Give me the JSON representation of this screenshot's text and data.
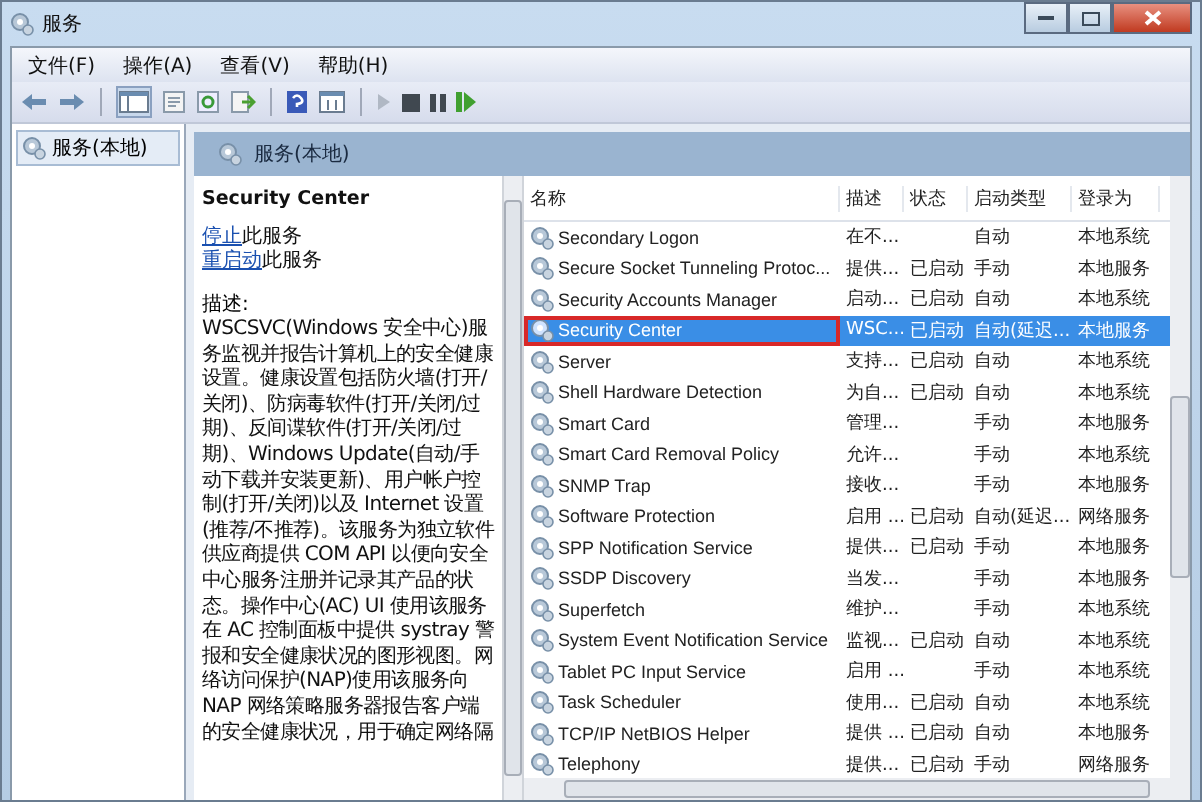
{
  "window": {
    "title": "服务"
  },
  "menu": [
    "文件(F)",
    "操作(A)",
    "查看(V)",
    "帮助(H)"
  ],
  "tree": {
    "items": [
      {
        "label": "服务(本地)",
        "selected": true
      }
    ]
  },
  "panel": {
    "header": "服务(本地)"
  },
  "detail": {
    "title": "Security Center",
    "actions": [
      {
        "link": "停止",
        "rest": "此服务"
      },
      {
        "link": "重启动",
        "rest": "此服务"
      }
    ],
    "description_label": "描述:",
    "description": "WSCSVC(Windows 安全中心)服务监视并报告计算机上的安全健康设置。健康设置包括防火墙(打开/关闭)、防病毒软件(打开/关闭/过期)、反间谍软件(打开/关闭/过期)、Windows Update(自动/手动下载并安装更新)、用户帐户控制(打开/关闭)以及 Internet 设置(推荐/不推荐)。该服务为独立软件供应商提供 COM API 以便向安全中心服务注册并记录其产品的状态。操作中心(AC) UI 使用该服务在 AC 控制面板中提供 systray 警报和安全健康状况的图形视图。网络访问保护(NAP)使用该服务向 NAP 网络策略服务器报告客户端的安全健康状况，用于确定网络隔"
  },
  "table": {
    "columns": [
      "名称",
      "描述",
      "状态",
      "启动类型",
      "登录为"
    ],
    "rows": [
      {
        "name": "Secondary Logon",
        "desc": "在不...",
        "status": "",
        "startup": "自动",
        "logon": "本地系统",
        "selected": false,
        "outlined": false
      },
      {
        "name": "Secure Socket Tunneling Protoc...",
        "desc": "提供...",
        "status": "已启动",
        "startup": "手动",
        "logon": "本地服务",
        "selected": false,
        "outlined": false
      },
      {
        "name": "Security Accounts Manager",
        "desc": "启动...",
        "status": "已启动",
        "startup": "自动",
        "logon": "本地系统",
        "selected": false,
        "outlined": false
      },
      {
        "name": "Security Center",
        "desc": "WSC...",
        "status": "已启动",
        "startup": "自动(延迟...",
        "logon": "本地服务",
        "selected": true,
        "outlined": true
      },
      {
        "name": "Server",
        "desc": "支持...",
        "status": "已启动",
        "startup": "自动",
        "logon": "本地系统",
        "selected": false,
        "outlined": false
      },
      {
        "name": "Shell Hardware Detection",
        "desc": "为自...",
        "status": "已启动",
        "startup": "自动",
        "logon": "本地系统",
        "selected": false,
        "outlined": false
      },
      {
        "name": "Smart Card",
        "desc": "管理...",
        "status": "",
        "startup": "手动",
        "logon": "本地服务",
        "selected": false,
        "outlined": false
      },
      {
        "name": "Smart Card Removal Policy",
        "desc": "允许...",
        "status": "",
        "startup": "手动",
        "logon": "本地系统",
        "selected": false,
        "outlined": false
      },
      {
        "name": "SNMP Trap",
        "desc": "接收...",
        "status": "",
        "startup": "手动",
        "logon": "本地服务",
        "selected": false,
        "outlined": false
      },
      {
        "name": "Software Protection",
        "desc": "启用 ...",
        "status": "已启动",
        "startup": "自动(延迟...",
        "logon": "网络服务",
        "selected": false,
        "outlined": false
      },
      {
        "name": "SPP Notification Service",
        "desc": "提供...",
        "status": "已启动",
        "startup": "手动",
        "logon": "本地服务",
        "selected": false,
        "outlined": false
      },
      {
        "name": "SSDP Discovery",
        "desc": "当发...",
        "status": "",
        "startup": "手动",
        "logon": "本地服务",
        "selected": false,
        "outlined": false
      },
      {
        "name": "Superfetch",
        "desc": "维护...",
        "status": "",
        "startup": "手动",
        "logon": "本地系统",
        "selected": false,
        "outlined": false
      },
      {
        "name": "System Event Notification Service",
        "desc": "监视...",
        "status": "已启动",
        "startup": "自动",
        "logon": "本地系统",
        "selected": false,
        "outlined": false
      },
      {
        "name": "Tablet PC Input Service",
        "desc": "启用 ...",
        "status": "",
        "startup": "手动",
        "logon": "本地系统",
        "selected": false,
        "outlined": false
      },
      {
        "name": "Task Scheduler",
        "desc": "使用...",
        "status": "已启动",
        "startup": "自动",
        "logon": "本地系统",
        "selected": false,
        "outlined": false
      },
      {
        "name": "TCP/IP NetBIOS Helper",
        "desc": "提供 ...",
        "status": "已启动",
        "startup": "自动",
        "logon": "本地服务",
        "selected": false,
        "outlined": false
      },
      {
        "name": "Telephony",
        "desc": "提供...",
        "status": "已启动",
        "startup": "手动",
        "logon": "网络服务",
        "selected": false,
        "outlined": false
      }
    ]
  }
}
